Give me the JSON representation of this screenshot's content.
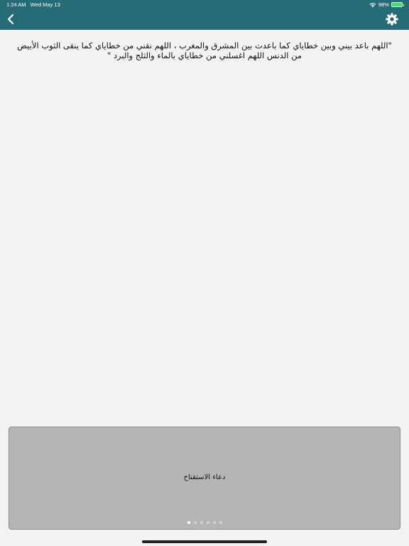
{
  "status_bar": {
    "time": "1:24 AM",
    "date": "Wed May 13",
    "battery_percent": "98%",
    "wifi_icon": "wifi-icon",
    "battery_icon": "battery-charging-icon"
  },
  "navbar": {
    "back_icon": "chevron-left-icon",
    "settings_icon": "gear-icon",
    "background_color": "#256c77"
  },
  "content": {
    "dua_text": "\"اللهم باعد بيني وبين خطاياي كما باعدت بين المشرق والمغرب ، اللهم نقني من خطاياي كما ينقى الثوب الأبيض من الدنس اللهم اغسلني من خطاياي بالماء والثلج والبرد \""
  },
  "card": {
    "title": "دعاء الاستفتاح",
    "page_count": 6,
    "active_page": 1
  }
}
